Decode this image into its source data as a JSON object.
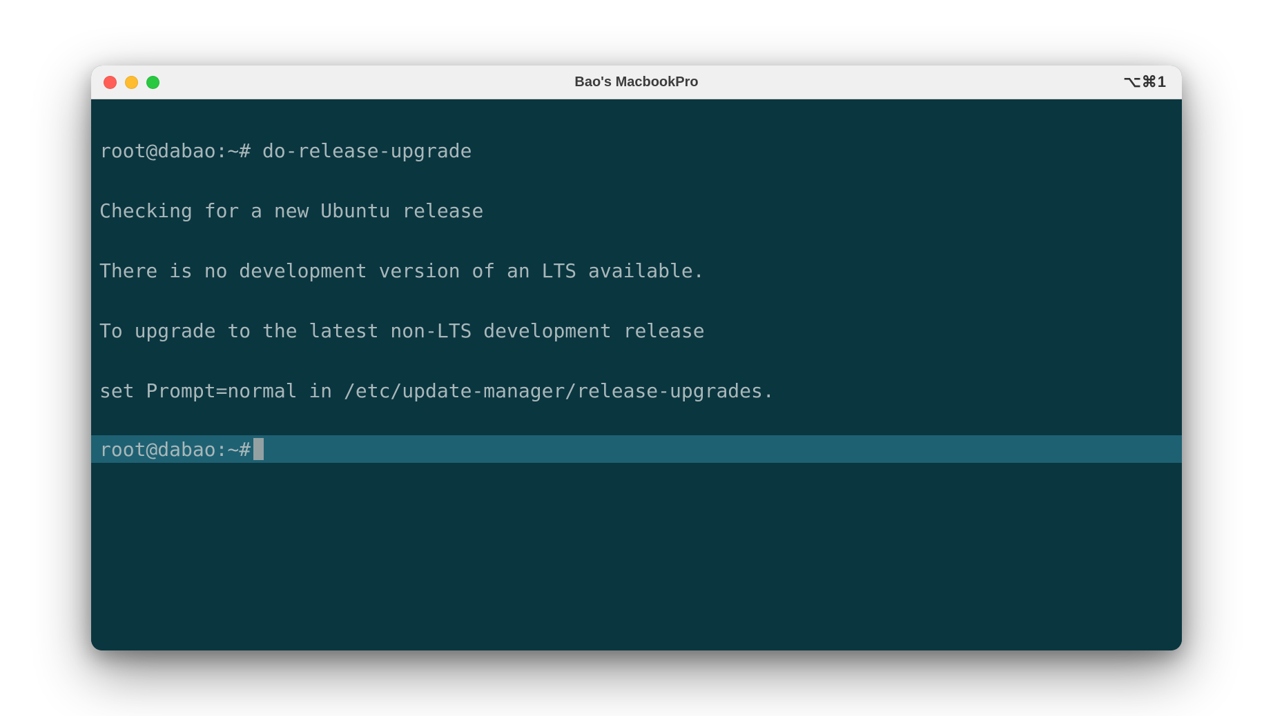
{
  "window": {
    "title": "Bao's MacbookPro",
    "shortcut": "⌥⌘1"
  },
  "terminal": {
    "prompt": "root@dabao:~#",
    "command": "do-release-upgrade",
    "output": [
      "Checking for a new Ubuntu release",
      "There is no development version of an LTS available.",
      "To upgrade to the latest non-LTS development release ",
      "set Prompt=normal in /etc/update-manager/release-upgrades."
    ],
    "active_prompt": "root@dabao:~#"
  },
  "colors": {
    "window_bg": "#0a3640",
    "titlebar_bg": "#f0f0f0",
    "text": "#a9b7b9",
    "highlight_bg": "#1e6173",
    "cursor": "#93a1a3",
    "traffic_red": "#ff5f57",
    "traffic_yellow": "#febc2e",
    "traffic_green": "#28c840"
  }
}
